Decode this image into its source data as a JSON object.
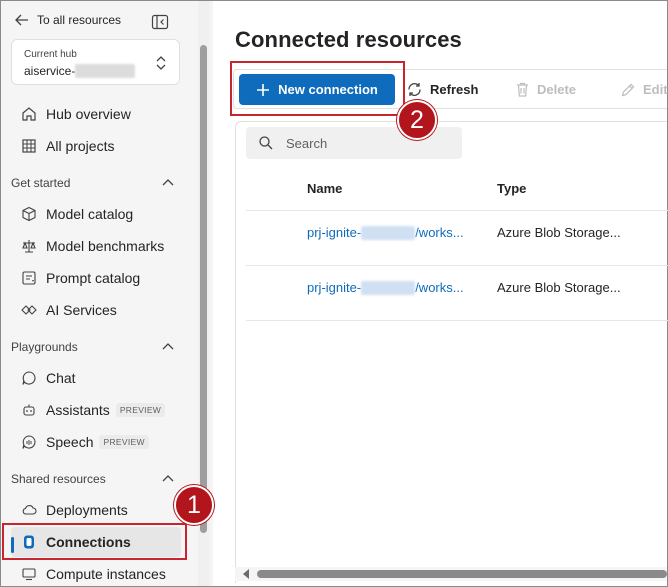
{
  "sidebar": {
    "back_label": "To all resources",
    "hub": {
      "label": "Current hub",
      "name": "aiservice-"
    },
    "items_top": [
      {
        "label": "Hub overview",
        "icon": "home-icon"
      },
      {
        "label": "All projects",
        "icon": "grid-icon"
      }
    ],
    "sections": [
      {
        "title": "Get started",
        "items": [
          {
            "label": "Model catalog",
            "icon": "cube-icon"
          },
          {
            "label": "Model benchmarks",
            "icon": "scale-icon"
          },
          {
            "label": "Prompt catalog",
            "icon": "prompt-icon"
          },
          {
            "label": "AI Services",
            "icon": "ai-services-icon"
          }
        ]
      },
      {
        "title": "Playgrounds",
        "items": [
          {
            "label": "Chat",
            "icon": "chat-icon"
          },
          {
            "label": "Assistants",
            "badge": "PREVIEW",
            "icon": "assistant-icon"
          },
          {
            "label": "Speech",
            "badge": "PREVIEW",
            "icon": "speech-icon"
          }
        ]
      },
      {
        "title": "Shared resources",
        "items": [
          {
            "label": "Deployments",
            "icon": "cloud-icon"
          },
          {
            "label": "Connections",
            "icon": "connections-icon",
            "active": true
          },
          {
            "label": "Compute instances",
            "icon": "computer-icon"
          }
        ]
      }
    ]
  },
  "main": {
    "title": "Connected resources",
    "toolbar": {
      "new_connection": "New connection",
      "refresh": "Refresh",
      "delete": "Delete",
      "edit": "Edit"
    },
    "search": {
      "placeholder": "Search"
    },
    "table": {
      "columns": [
        "Name",
        "Type"
      ],
      "rows": [
        {
          "name_prefix": "prj-ignite-",
          "name_suffix": "/works...",
          "type": "Azure Blob Storage..."
        },
        {
          "name_prefix": "prj-ignite-",
          "name_suffix": "/works...",
          "type": "Azure Blob Storage..."
        }
      ]
    }
  },
  "annotations": {
    "marker_1": "1",
    "marker_2": "2"
  },
  "colors": {
    "accent": "#0f6cbd",
    "annotation_red": "#c8262e"
  }
}
